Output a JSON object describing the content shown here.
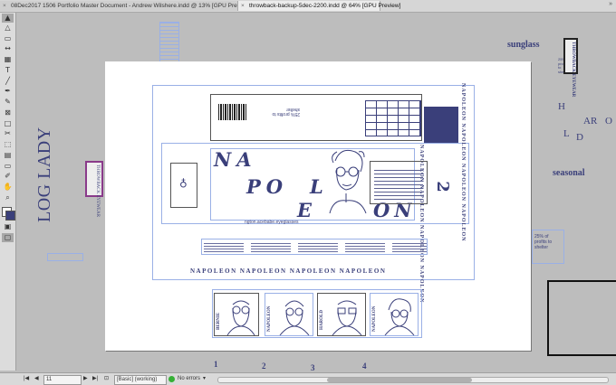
{
  "tabs": [
    {
      "label": "08Dec2017 1506 Portfolio Master Document - Andrew Wilshere.indd @ 13% [GPU Preview]"
    },
    {
      "label": "throwback-backup-5dec-2200.indd @ 64% [GPU Preview]"
    }
  ],
  "canvas": {
    "log_lady": "LOG LADY",
    "sunglass": "sunglass",
    "seasonal": "seasonal",
    "throwback_eyewear": "THROWBACK EYEWEAR",
    "harold_letters": [
      "H",
      "AR",
      "O",
      "L",
      "D"
    ],
    "percent_note": "25% of profits to shelter",
    "page_numbers": [
      "1",
      "2",
      "3",
      "4"
    ]
  },
  "page": {
    "napoleon_letters": [
      "NA",
      "PO",
      "L",
      "E",
      "ON"
    ],
    "napoleon_band": "NAPOLEON NAPOLEON NAPOLEON NAPOLEON",
    "napoleon_vertical": "NAPOLEON NAPOLEON NAPOLEON NAPOLEON",
    "url": "ngton.acebabe.eyeglasses",
    "profits": "25% profits to shelter",
    "number": "2",
    "thumbs": [
      "BERNIE",
      "NAPOLEON",
      "HAROLD",
      "NAPOLEON"
    ]
  },
  "status": {
    "page": "11",
    "style": "[Basic] (working)",
    "errors": "No errors"
  },
  "colors": {
    "navy": "#3a3f7a",
    "frame": "#9ab0e6"
  }
}
